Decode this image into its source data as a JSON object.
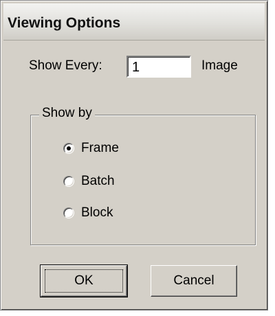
{
  "dialog": {
    "title": "Viewing Options"
  },
  "show_every": {
    "label": "Show Every:",
    "value": "1",
    "unit": "Image"
  },
  "show_by": {
    "legend": "Show by",
    "options": [
      {
        "label": "Frame",
        "selected": true
      },
      {
        "label": "Batch",
        "selected": false
      },
      {
        "label": "Block",
        "selected": false
      }
    ]
  },
  "buttons": {
    "ok": "OK",
    "cancel": "Cancel"
  }
}
